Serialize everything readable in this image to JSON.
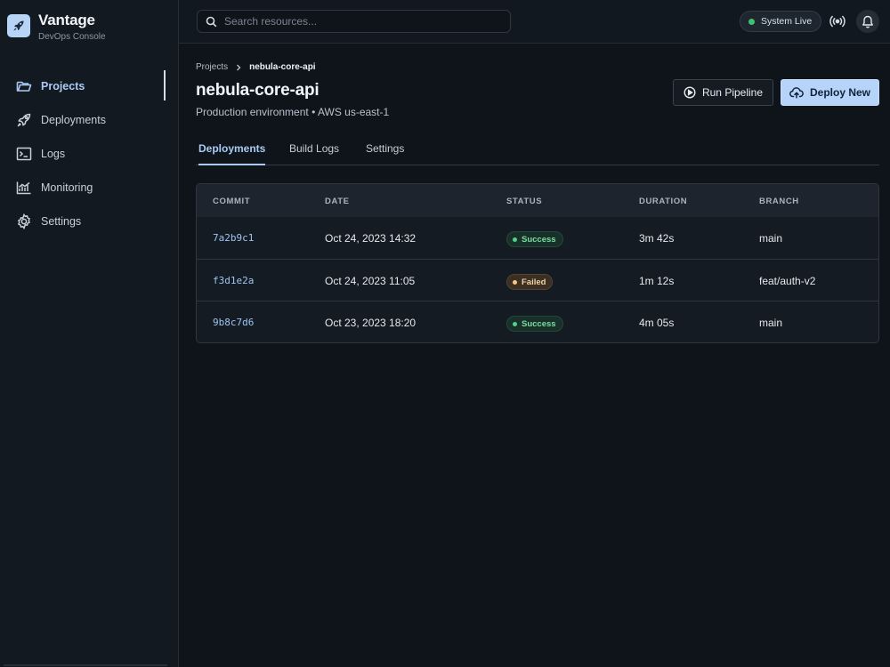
{
  "brand": {
    "title": "Vantage",
    "subtitle": "DevOps Console",
    "logo_icon": "rocket-icon"
  },
  "sidebar": {
    "items": [
      {
        "label": "Projects",
        "icon": "folder-icon",
        "active": true
      },
      {
        "label": "Deployments",
        "icon": "rocket-icon",
        "active": false
      },
      {
        "label": "Logs",
        "icon": "terminal-icon",
        "active": false
      },
      {
        "label": "Monitoring",
        "icon": "chart-icon",
        "active": false
      },
      {
        "label": "Settings",
        "icon": "gear-icon",
        "active": false
      }
    ]
  },
  "header": {
    "search_placeholder": "Search resources...",
    "status_label": "System Live",
    "status_color": "#3fbf6f"
  },
  "breadcrumb": {
    "parent": "Projects",
    "current": "nebula-core-api"
  },
  "project": {
    "title": "nebula-core-api",
    "subtitle": "Production environment • AWS us-east-1"
  },
  "actions": {
    "run_label": "Run Pipeline",
    "deploy_label": "Deploy New"
  },
  "tabs": [
    {
      "label": "Deployments",
      "active": true
    },
    {
      "label": "Build Logs",
      "active": false
    },
    {
      "label": "Settings",
      "active": false
    }
  ],
  "table": {
    "headers": [
      "COMMIT",
      "DATE",
      "STATUS",
      "DURATION",
      "BRANCH"
    ],
    "rows": [
      {
        "commit": "7a2b9c1",
        "date": "Oct 24, 2023 14:32",
        "status": "Success",
        "duration": "3m 42s",
        "branch": "main"
      },
      {
        "commit": "f3d1e2a",
        "date": "Oct 24, 2023 11:05",
        "status": "Failed",
        "duration": "1m 12s",
        "branch": "feat/auth-v2"
      },
      {
        "commit": "9b8c7d6",
        "date": "Oct 23, 2023 18:20",
        "status": "Success",
        "duration": "4m 05s",
        "branch": "main"
      }
    ]
  },
  "colors": {
    "accent": "#a9cbf3",
    "primary_button": "#b6d4fa",
    "success": "#59d08a",
    "failed": "#f3c98a"
  }
}
